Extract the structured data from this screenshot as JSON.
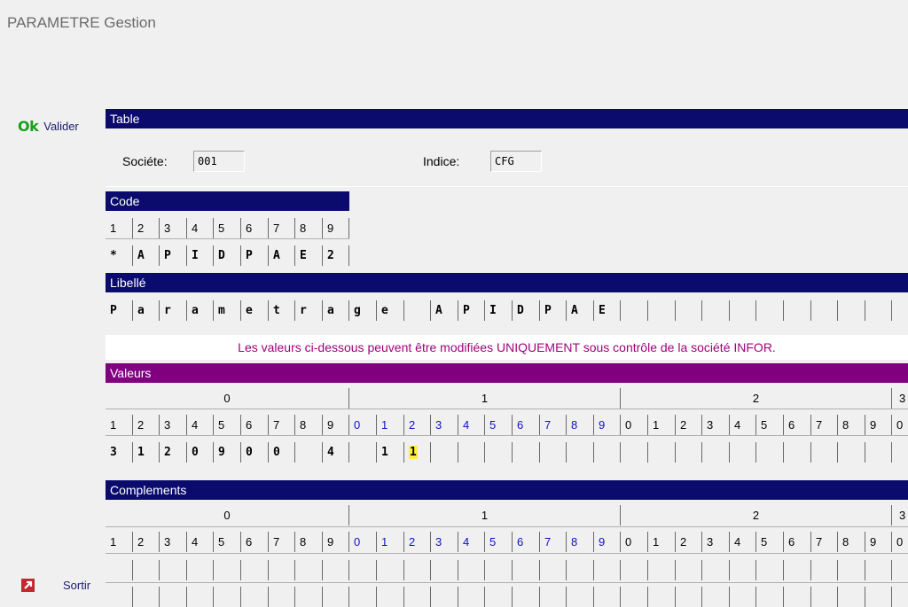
{
  "window": {
    "title": "PARAMETRE Gestion"
  },
  "actions": {
    "ok_glyph": "Ok",
    "ok_label": "Valider",
    "exit_label": "Sortir"
  },
  "table_section": {
    "header": "Table",
    "societe_label": "Sociéte:",
    "societe_value": "001",
    "indice_label": "Indice:",
    "indice_value": "CFG"
  },
  "code_section": {
    "header": "Code",
    "positions": [
      "1",
      "2",
      "3",
      "4",
      "5",
      "6",
      "7",
      "8",
      "9"
    ],
    "chars": [
      "*",
      "A",
      "P",
      "I",
      "D",
      "P",
      "A",
      "E",
      "2"
    ]
  },
  "libelle_section": {
    "header": "Libellé",
    "chars": [
      "P",
      "a",
      "r",
      "a",
      "m",
      "e",
      "t",
      "r",
      "a",
      "g",
      "e",
      "",
      "A",
      "P",
      "I",
      "D",
      "P",
      "A",
      "E",
      "",
      "",
      "",
      "",
      "",
      "",
      "",
      "",
      "",
      ""
    ]
  },
  "warning": "Les valeurs ci-dessous peuvent être modifiées UNIQUEMENT sous contrôle de la société INFOR.",
  "valeurs_section": {
    "header": "Valeurs",
    "groups": [
      "0",
      "1",
      "2",
      "3"
    ],
    "positions": [
      "1",
      "2",
      "3",
      "4",
      "5",
      "6",
      "7",
      "8",
      "9",
      "0",
      "1",
      "2",
      "3",
      "4",
      "5",
      "6",
      "7",
      "8",
      "9",
      "0",
      "1",
      "2",
      "3",
      "4",
      "5",
      "6",
      "7",
      "8",
      "9",
      "0"
    ],
    "values": [
      "3",
      "1",
      "2",
      "0",
      "9",
      "0",
      "0",
      "",
      "4",
      "",
      "1",
      "1",
      "",
      "",
      "",
      "",
      "",
      "",
      "",
      "",
      "",
      "",
      "",
      "",
      "",
      "",
      "",
      "",
      "",
      ""
    ],
    "highlight_index": 11
  },
  "complements_section": {
    "header": "Complements",
    "groups": [
      "0",
      "1",
      "2",
      "3"
    ],
    "positions": [
      "1",
      "2",
      "3",
      "4",
      "5",
      "6",
      "7",
      "8",
      "9",
      "0",
      "1",
      "2",
      "3",
      "4",
      "5",
      "6",
      "7",
      "8",
      "9",
      "0",
      "1",
      "2",
      "3",
      "4",
      "5",
      "6",
      "7",
      "8",
      "9",
      "0"
    ]
  },
  "colors": {
    "navy": "#0b0b6e",
    "purple": "#800080",
    "warning_text": "#a0007a",
    "highlight": "#ffef3a",
    "ok_green": "#1aa01a"
  }
}
